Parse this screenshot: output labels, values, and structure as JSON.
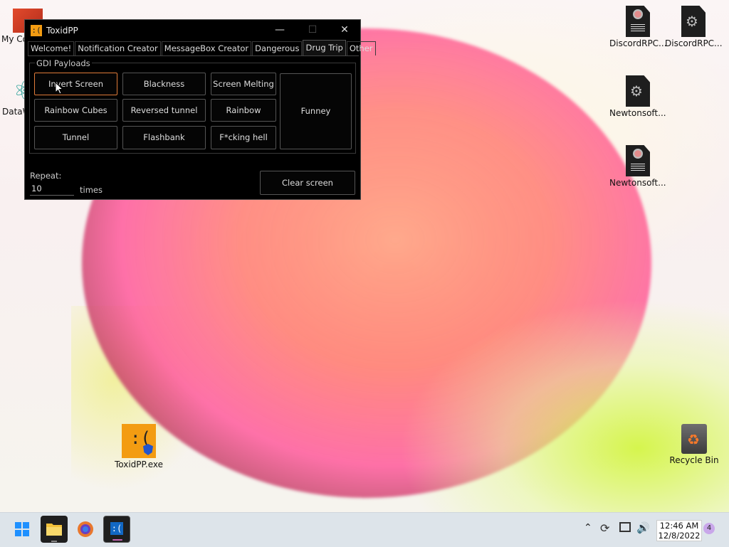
{
  "desktop": {
    "icons_left": [
      {
        "label": "My Co"
      },
      {
        "label": "DataW"
      }
    ],
    "icons_right": [
      {
        "label": "DiscordRPC...",
        "icon": "document-face-icon"
      },
      {
        "label": "DiscordRPC...",
        "icon": "document-gear-icon"
      },
      {
        "label": "Newtonsoft....",
        "icon": "document-gear-icon"
      },
      {
        "label": "Newtonsoft....",
        "icon": "document-face-icon"
      }
    ],
    "toxid_exe": {
      "label": "ToxidPP.exe",
      "glyph": ":("
    },
    "recycle_bin": {
      "label": "Recycle Bin"
    }
  },
  "window": {
    "app_icon_glyph": ":(",
    "title": "ToxidPP",
    "minimize": "—",
    "maximize": "☐",
    "close": "✕",
    "tabs": [
      "Welcome!",
      "Notification Creator",
      "MessageBox Creator",
      "Dangerous",
      "Drug Trip",
      "Other"
    ],
    "active_tab": "Drug Trip",
    "group_label": "GDI Payloads",
    "payloads": {
      "invert_screen": "Invert Screen",
      "blackness": "Blackness",
      "screen_melting": "Screen Melting",
      "rainbow_cubes": "Rainbow Cubes",
      "reversed_tunnel": "Reversed tunnel",
      "rainbow": "Rainbow",
      "tunnel": "Tunnel",
      "flashbank": "Flashbank",
      "fcking_hell": "F*cking hell",
      "funney": "Funney"
    },
    "repeat_label": "Repeat:",
    "repeat_value": "10",
    "times_label": "times",
    "clear_screen": "Clear screen"
  },
  "taskbar": {
    "time": "12:46 AM",
    "date": "12/8/2022",
    "notification_count": "4",
    "toxid_glyph": ":("
  }
}
